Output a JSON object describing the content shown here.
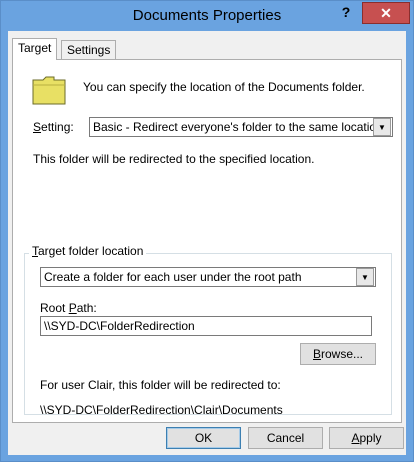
{
  "window": {
    "title": "Documents Properties",
    "help_label": "?",
    "close_label": "✕"
  },
  "tabs": [
    {
      "label": "Target",
      "active": true
    },
    {
      "label": "Settings",
      "active": false
    }
  ],
  "target": {
    "description": "You can specify the location of the Documents folder.",
    "setting_label_prefix": "S",
    "setting_label_rest": "etting:",
    "setting_value": "Basic - Redirect everyone's folder to the same location",
    "redirect_note": "This folder will be redirected to the specified location.",
    "group_label_prefix": "T",
    "group_label_rest": "arget folder location",
    "location_option": "Create a folder for each user under the root path",
    "root_path_label_prefix": "Root ",
    "root_path_label_u": "P",
    "root_path_label_rest": "ath:",
    "root_path_value": "\\\\SYD-DC\\FolderRedirection",
    "browse_label_u": "B",
    "browse_label_rest": "rowse...",
    "example_note": "For user Clair, this folder will be redirected to:",
    "example_path": "\\\\SYD-DC\\FolderRedirection\\Clair\\Documents"
  },
  "footer": {
    "ok_label": "OK",
    "cancel_label": "Cancel",
    "apply_label_u": "A",
    "apply_label_rest": "pply"
  },
  "colors": {
    "titlebar": "#6aa3e0",
    "close_button": "#c75050",
    "folder": "#e8e064"
  },
  "icons": {
    "folder": "folder-icon",
    "dropdown": "chevron-down-icon",
    "close": "close-icon",
    "help": "help-icon"
  }
}
